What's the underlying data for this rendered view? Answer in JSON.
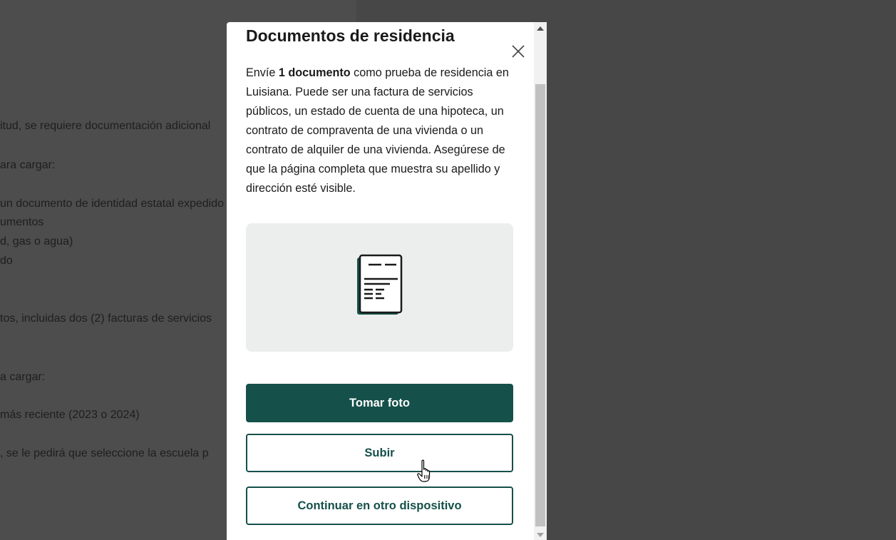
{
  "background": {
    "lines": [
      "itud, se requiere documentación adicional",
      "ara cargar:",
      "un documento de identidad estatal expedido",
      "umentos",
      "d, gas o agua)",
      "do",
      "tos, incluidas dos (2) facturas de servicios",
      "a cargar:",
      "más reciente (2023 o 2024)",
      ", se le pedirá que seleccione la escuela p"
    ]
  },
  "modal": {
    "title": "Documentos de residencia",
    "description_prefix": "Envíe ",
    "description_bold": "1 documento",
    "description_rest": " como prueba de residencia en Luisiana. Puede ser una factura de servicios públicos, un estado de cuenta de una hipoteca, un contrato de compraventa de una vivienda o un contrato de alquiler de una vivienda. Asegúrese de que la página completa que muestra su apellido y dirección esté visible.",
    "illustration_icon": "document-icon",
    "buttons": {
      "take_photo": "Tomar foto",
      "upload": "Subir",
      "continue_other_device": "Continuar en otro dispositivo"
    },
    "close_icon": "close-icon"
  },
  "colors": {
    "primary": "#15504a",
    "overlay": "#4a4a4a",
    "illustration_bg": "#eceeed"
  }
}
